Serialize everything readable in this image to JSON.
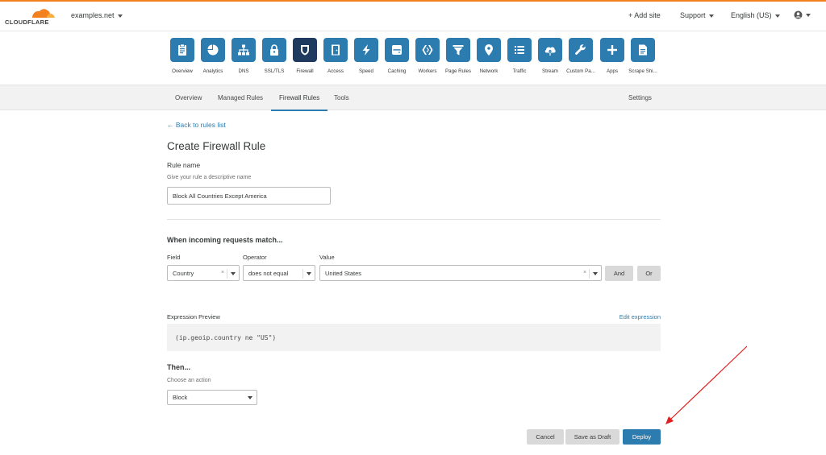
{
  "brand": {
    "name": "CLOUDFLARE",
    "accent": "#f48120",
    "primary": "#2c7cb0",
    "active_icon": "#1e3a5f"
  },
  "topbar": {
    "domain": "examples.net",
    "add_site": "+ Add site",
    "support": "Support",
    "language": "English (US)",
    "user_icon": "user-circle-icon"
  },
  "app_icons": [
    {
      "label": "Overview",
      "icon": "clipboard-icon"
    },
    {
      "label": "Analytics",
      "icon": "pie-chart-icon"
    },
    {
      "label": "DNS",
      "icon": "network-tree-icon"
    },
    {
      "label": "SSL/TLS",
      "icon": "lock-icon"
    },
    {
      "label": "Firewall",
      "icon": "shield-icon",
      "active": true
    },
    {
      "label": "Access",
      "icon": "door-icon"
    },
    {
      "label": "Speed",
      "icon": "lightning-icon"
    },
    {
      "label": "Caching",
      "icon": "server-icon"
    },
    {
      "label": "Workers",
      "icon": "workers-icon"
    },
    {
      "label": "Page Rules",
      "icon": "filter-icon"
    },
    {
      "label": "Network",
      "icon": "location-pin-icon"
    },
    {
      "label": "Traffic",
      "icon": "list-icon"
    },
    {
      "label": "Stream",
      "icon": "cloud-upload-icon"
    },
    {
      "label": "Custom Pa...",
      "icon": "wrench-icon"
    },
    {
      "label": "Apps",
      "icon": "plus-icon"
    },
    {
      "label": "Scrape Shi...",
      "icon": "document-icon"
    }
  ],
  "subnav": {
    "tabs": [
      "Overview",
      "Managed Rules",
      "Firewall Rules",
      "Tools"
    ],
    "active_tab": "Firewall Rules",
    "settings": "Settings"
  },
  "form": {
    "back_link": "← Back to rules list",
    "title": "Create Firewall Rule",
    "rule_name_label": "Rule name",
    "rule_name_hint": "Give your rule a descriptive name",
    "rule_name_value": "Block All Countries Except America",
    "match_heading": "When incoming requests match...",
    "field_label": "Field",
    "operator_label": "Operator",
    "value_label": "Value",
    "field_value": "Country",
    "operator_value": "does not equal",
    "value_value": "United States",
    "and_button": "And",
    "or_button": "Or",
    "expression_label": "Expression Preview",
    "edit_expression": "Edit expression",
    "expression": "(ip.geoip.country ne \"US\")",
    "then_heading": "Then...",
    "action_hint": "Choose an action",
    "action_value": "Block",
    "cancel_button": "Cancel",
    "draft_button": "Save as Draft",
    "deploy_button": "Deploy"
  },
  "annotation": {
    "arrow_color": "#e02020"
  }
}
